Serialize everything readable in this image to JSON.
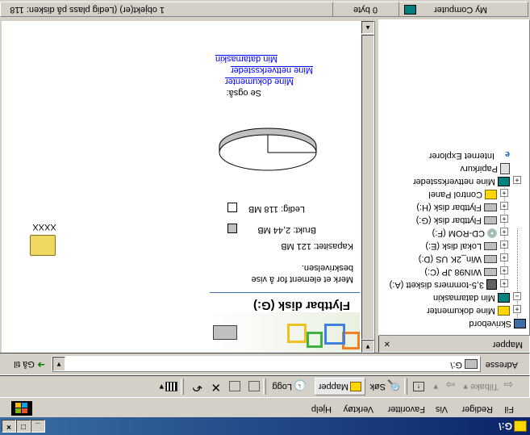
{
  "window": {
    "title": "G:\\"
  },
  "menu": [
    "Fil",
    "Rediger",
    "Vis",
    "Favoritter",
    "Verktøy",
    "Hjelp"
  ],
  "toolbar": {
    "back": "Tilbake",
    "search": "Søk",
    "folders": "Mapper",
    "history": "Logg"
  },
  "address": {
    "label": "Adresse",
    "value": "G:\\",
    "go": "Gå til"
  },
  "folders_pane": {
    "title": "Mapper",
    "tree": [
      "Skrivebord",
      "Mine dokumenter",
      "Min datamaskin",
      "3,5-tommers diskett (A:)",
      "WIN98 JP (C:)",
      "Win_2K US (D:)",
      "Lokal disk (E:)",
      "CD-ROM (F:)",
      "Flyttbar disk (G:)",
      "Flyttbar disk (H:)",
      "Control Panel",
      "Mine nettverkssteder",
      "Papirkurv",
      "Internet Explorer"
    ]
  },
  "info_pane": {
    "drive_title": "Flyttbar disk (G:)",
    "hint": "Merk et element for å vise beskrivelsen.",
    "capacity": "Kapasitet: 121 MB",
    "used": "Brukt: 2,44 MB",
    "free": "Ledig: 118 MB",
    "see_also": "Se også:",
    "links": [
      "Mine dokumenter",
      "Mine nettverkssteder",
      "Min datamaskin"
    ],
    "colors": {
      "used": "#c0c0c0",
      "free": "#ffffff"
    }
  },
  "content": {
    "files": [
      {
        "name": "XXXX",
        "icon": "folder-icon"
      }
    ]
  },
  "status": {
    "objects": "1 objekt(er) (Ledig plass på disken: 118 MB)",
    "size": "0 byte",
    "zone": "My Computer"
  }
}
